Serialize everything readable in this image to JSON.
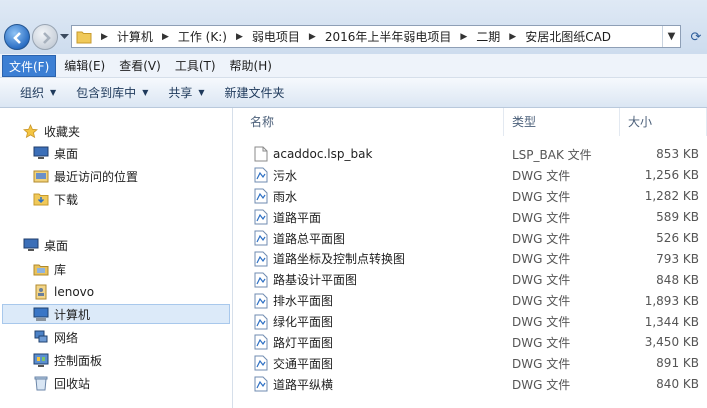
{
  "address": {
    "crumbs": [
      "计算机",
      "工作 (K:)",
      "弱电项目",
      "2016年上半年弱电项目",
      "二期",
      "安居北图纸CAD"
    ]
  },
  "menu": [
    "文件(F)",
    "编辑(E)",
    "查看(V)",
    "工具(T)",
    "帮助(H)"
  ],
  "toolbar": {
    "organize": "组织",
    "include_library": "包含到库中",
    "share": "共享",
    "new_folder": "新建文件夹"
  },
  "nav": {
    "favorites": "收藏夹",
    "desktop_fav": "桌面",
    "recent": "最近访问的位置",
    "downloads": "下载",
    "desktop": "桌面",
    "library": "库",
    "user": "lenovo",
    "computer": "计算机",
    "network": "网络",
    "control_panel": "控制面板",
    "recycle_bin": "回收站"
  },
  "columns": {
    "name": "名称",
    "type": "类型",
    "size": "大小"
  },
  "files": [
    {
      "name": "acaddoc.lsp_bak",
      "type": "LSP_BAK 文件",
      "size": "853 KB"
    },
    {
      "name": "污水",
      "type": "DWG 文件",
      "size": "1,256 KB"
    },
    {
      "name": "雨水",
      "type": "DWG 文件",
      "size": "1,282 KB"
    },
    {
      "name": "道路平面",
      "type": "DWG 文件",
      "size": "589 KB"
    },
    {
      "name": "道路总平面图",
      "type": "DWG 文件",
      "size": "526 KB"
    },
    {
      "name": "道路坐标及控制点转换图",
      "type": "DWG 文件",
      "size": "793 KB"
    },
    {
      "name": "路基设计平面图",
      "type": "DWG 文件",
      "size": "848 KB"
    },
    {
      "name": "排水平面图",
      "type": "DWG 文件",
      "size": "1,893 KB"
    },
    {
      "name": "绿化平面图",
      "type": "DWG 文件",
      "size": "1,344 KB"
    },
    {
      "name": "路灯平面图",
      "type": "DWG 文件",
      "size": "3,450 KB"
    },
    {
      "name": "交通平面图",
      "type": "DWG 文件",
      "size": "891 KB"
    },
    {
      "name": "道路平纵横",
      "type": "DWG 文件",
      "size": "840 KB"
    }
  ],
  "colors": {
    "menu_active": "#3c7fd4",
    "nav_selected": "#dceaf9",
    "toolbar_text": "#1e395b"
  }
}
